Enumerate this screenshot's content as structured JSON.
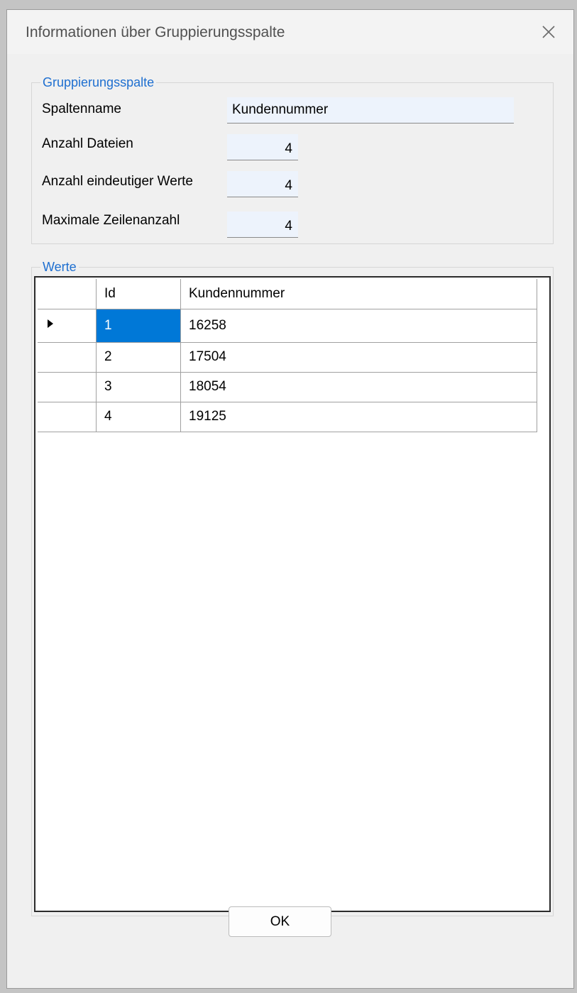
{
  "window": {
    "title": "Informationen über Gruppierungsspalte"
  },
  "group_info": {
    "legend": "Gruppierungsspalte",
    "column_name_label": "Spaltenname",
    "column_name_value": "Kundennummer",
    "files_count_label": "Anzahl Dateien",
    "files_count_value": "4",
    "unique_values_label": "Anzahl eindeutiger Werte",
    "unique_values_value": "4",
    "max_rows_label": "Maximale Zeilenanzahl",
    "max_rows_value": "4"
  },
  "values_group": {
    "legend": "Werte",
    "columns": [
      "Id",
      "Kundennummer"
    ],
    "rows": [
      {
        "id": "1",
        "kundennummer": "16258"
      },
      {
        "id": "2",
        "kundennummer": "17504"
      },
      {
        "id": "3",
        "kundennummer": "18054"
      },
      {
        "id": "4",
        "kundennummer": "19125"
      }
    ],
    "current_row_indicator": "row-pointer-icon"
  },
  "footer": {
    "ok_label": "OK"
  },
  "colors": {
    "legend_blue": "#1e6fd0",
    "selection": "#0078d7",
    "field_bg": "#edf3fc"
  }
}
